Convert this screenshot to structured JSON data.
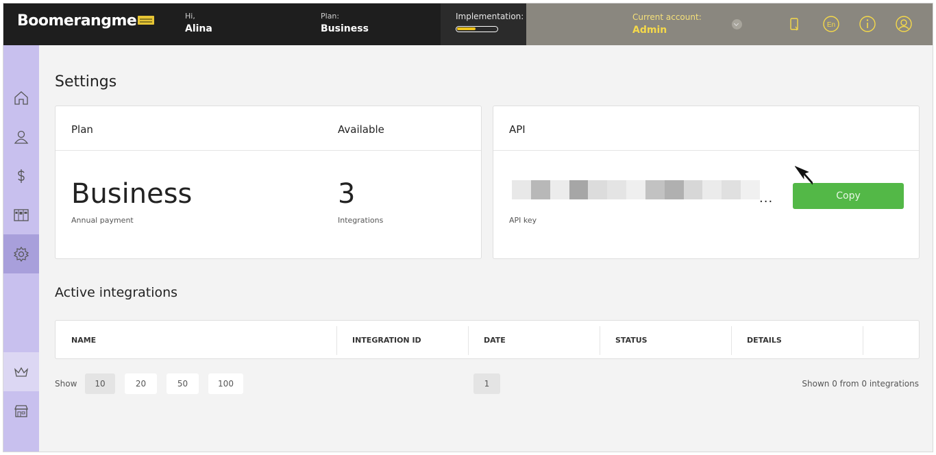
{
  "header": {
    "brand": "Boomerangme",
    "greeting_label": "Hi,",
    "user_name": "Alina",
    "plan_label": "Plan:",
    "plan_value": "Business",
    "implementation_label": "Implementation:",
    "implementation_progress": 0.45,
    "account_label": "Current account:",
    "account_value": "Admin",
    "icons": [
      "phone-icon",
      "language-en-icon",
      "info-icon",
      "user-profile-icon"
    ],
    "language": "En"
  },
  "sidebar": {
    "items": [
      {
        "name": "home-icon"
      },
      {
        "name": "customers-icon"
      },
      {
        "name": "dollar-icon"
      },
      {
        "name": "cards-icon"
      },
      {
        "name": "settings-icon",
        "active": true
      },
      {
        "name": "crown-icon"
      },
      {
        "name": "store-icon"
      }
    ]
  },
  "page": {
    "title": "Settings",
    "plan_card": {
      "plan_header": "Plan",
      "available_header": "Available",
      "plan_value": "Business",
      "plan_sub": "Annual payment",
      "available_value": "3",
      "available_sub": "Integrations"
    },
    "api_card": {
      "header": "API",
      "key_dots": "...",
      "key_label": "API key",
      "copy_label": "Copy"
    },
    "integrations": {
      "title": "Active integrations",
      "columns": [
        "NAME",
        "INTEGRATION ID",
        "DATE",
        "STATUS",
        "DETAILS"
      ],
      "rows": []
    },
    "pagination": {
      "show_label": "Show",
      "sizes": [
        "10",
        "20",
        "50",
        "100"
      ],
      "selected_size": "10",
      "pages": [
        "1"
      ],
      "summary": "Shown 0 from 0 integrations"
    }
  },
  "colors": {
    "topbar": "#1e1e1e",
    "account_bg": "#8a877f",
    "sidebar": "#c8c0ee",
    "sidebar_active": "#a89fdb",
    "copy_button": "#53b847",
    "progress": "#f0c419"
  }
}
